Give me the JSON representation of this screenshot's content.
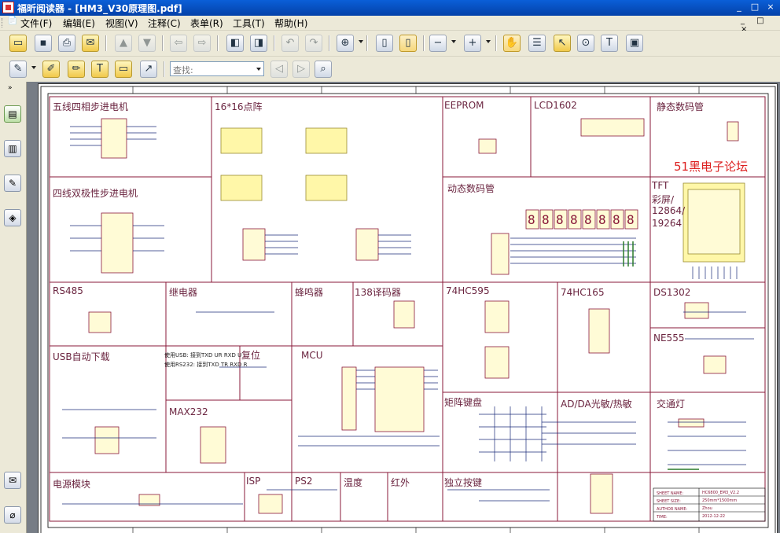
{
  "window": {
    "title": "福昕阅读器 - [HM3_V30原理图.pdf]",
    "controls": [
      "_",
      "□",
      "×"
    ]
  },
  "menu": {
    "items": [
      "文件(F)",
      "编辑(E)",
      "视图(V)",
      "注释(C)",
      "表单(R)",
      "工具(T)",
      "帮助(H)"
    ],
    "mdi_controls": "_ □ ×"
  },
  "toolbar": {
    "search_placeholder": "查找:"
  },
  "leftbar": {
    "collapse_glyph": "»"
  },
  "schematic": {
    "sections": [
      "五线四相步进电机",
      "16*16点阵",
      "EEPROM",
      "LCD1602",
      "静态数码管",
      "四线双极性步进电机",
      "动态数码管",
      "TFT",
      "彩屏/",
      "12864/",
      "19264",
      "RS485",
      "继电器",
      "蜂鸣器",
      "138译码器",
      "74HC595",
      "74HC165",
      "DS1302",
      "USB自动下载",
      "复位",
      "MCU",
      "NE555",
      "MAX232",
      "矩阵键盘",
      "AD/DA光敏/热敏",
      "交通灯",
      "电源模块",
      "ISP",
      "PS2",
      "温度",
      "红外",
      "独立按键"
    ],
    "usb_note_1": "使用USB: 接到TXD UR RXD U",
    "usb_note_2": "使用RS232: 接到TXD TR RXD R",
    "watermark": "51黑电子论坛",
    "seg_digit": "8",
    "title_block": {
      "labels": [
        "SHEET NAME:",
        "SHEET SIZE:",
        "AUTHOR NAME:",
        "TIME:"
      ],
      "values": [
        "HC6800_EM3_V2.2",
        "250mm*1500mm",
        "Zhou",
        "2012-12-22"
      ]
    }
  }
}
